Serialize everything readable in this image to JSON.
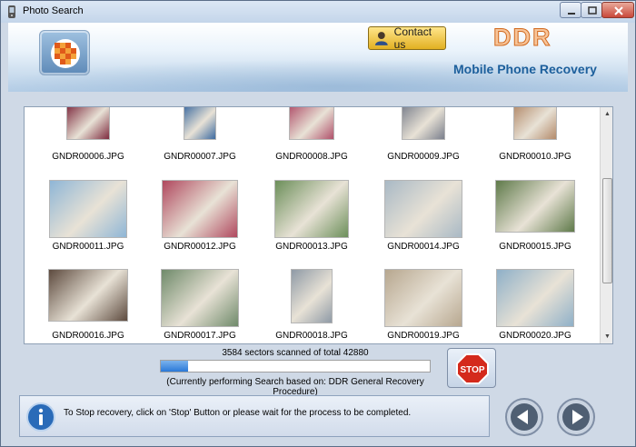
{
  "window": {
    "title": "Photo Search"
  },
  "header": {
    "contact_label": "Contact us",
    "brand": "DDR",
    "product": "Mobile Phone Recovery",
    "colors": {
      "brand_fill": "#f7c59a",
      "brand_stroke": "#d2691e",
      "product_text": "#1c5f9c"
    }
  },
  "gallery": {
    "items": [
      {
        "name": "GNDR00006.JPG"
      },
      {
        "name": "GNDR00007.JPG"
      },
      {
        "name": "GNDR00008.JPG"
      },
      {
        "name": "GNDR00009.JPG"
      },
      {
        "name": "GNDR00010.JPG"
      },
      {
        "name": "GNDR00011.JPG"
      },
      {
        "name": "GNDR00012.JPG"
      },
      {
        "name": "GNDR00013.JPG"
      },
      {
        "name": "GNDR00014.JPG"
      },
      {
        "name": "GNDR00015.JPG"
      },
      {
        "name": "GNDR00016.JPG"
      },
      {
        "name": "GNDR00017.JPG"
      },
      {
        "name": "GNDR00018.JPG"
      },
      {
        "name": "GNDR00019.JPG"
      },
      {
        "name": "GNDR00020.JPG"
      }
    ]
  },
  "progress": {
    "sectors_text": "3584 sectors scanned of total 42880",
    "fraction": 0.1,
    "status_text": "(Currently performing Search based on:  DDR General Recovery Procedure)"
  },
  "stop": {
    "label": "STOP"
  },
  "info": {
    "text": "To Stop recovery, click on 'Stop' Button or please wait for the process to be completed."
  },
  "icons": {
    "app": "phone-icon",
    "logo": "checker-sphere-logo",
    "contact": "person-icon",
    "info": "info-icon",
    "stop": "stop-sign-icon",
    "back": "back-arrow-icon",
    "next": "next-arrow-icon"
  }
}
